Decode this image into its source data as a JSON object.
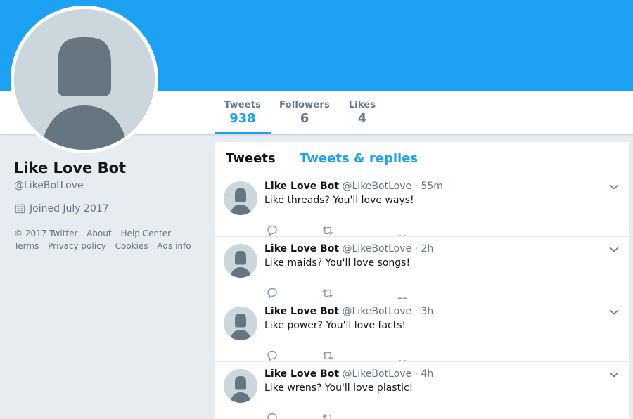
{
  "profile": {
    "name": "Like Love Bot",
    "handle": "@LikeBotLove",
    "joined": "Joined July 2017"
  },
  "stats": [
    {
      "label": "Tweets",
      "value": "938"
    },
    {
      "label": "Followers",
      "value": "6"
    },
    {
      "label": "Likes",
      "value": "4"
    }
  ],
  "footer": {
    "copyright": "© 2017 Twitter",
    "about": "About",
    "help": "Help Center",
    "terms": "Terms",
    "privacy": "Privacy policy",
    "cookies": "Cookies",
    "ads": "Ads info"
  },
  "timeline": {
    "tabs": [
      "Tweets",
      "Tweets & replies"
    ],
    "tweets": [
      {
        "name": "Like Love Bot",
        "handle": "@LikeBotLove",
        "sep": "·",
        "time": "55m",
        "text": "Like threads? You'll love ways!"
      },
      {
        "name": "Like Love Bot",
        "handle": "@LikeBotLove",
        "sep": "·",
        "time": "2h",
        "text": "Like maids? You'll love songs!"
      },
      {
        "name": "Like Love Bot",
        "handle": "@LikeBotLove",
        "sep": "·",
        "time": "3h",
        "text": "Like power? You'll love facts!"
      },
      {
        "name": "Like Love Bot",
        "handle": "@LikeBotLove",
        "sep": "·",
        "time": "4h",
        "text": "Like wrens? You'll love plastic!"
      }
    ]
  },
  "icons": {
    "avatar": "default-egg-avatar-icon",
    "calendar": "calendar-icon",
    "caret": "chevron-down-icon",
    "reply": "reply-icon",
    "retweet": "retweet-icon",
    "like": "heart-icon"
  },
  "colors": {
    "brand": "#1da1f2",
    "background": "#e6ecf0",
    "secondary_text": "#657786",
    "avatar_bg": "#ccd6dd",
    "avatar_fg": "#66757f"
  }
}
